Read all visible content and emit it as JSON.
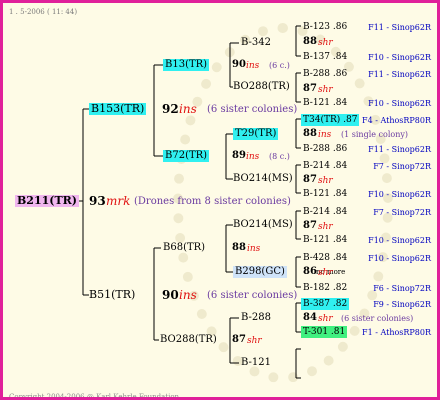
{
  "header": "1 .  5-2006 ( 11: 44)",
  "copyright": "Copyright 2004-2006 @ Karl Kehrle Foundation.",
  "root": {
    "label": "B211(TR)",
    "num": "93",
    "race": "mrk",
    "note": "(Drones from 8 sister colonies)"
  },
  "b153": {
    "label": "B153(TR)",
    "num": "92",
    "race": "ins",
    "note": "(6 sister colonies)"
  },
  "b51": {
    "label": "B51(TR)",
    "num": "90",
    "race": "ins",
    "note": "(6 sister colonies)"
  },
  "b13": {
    "label": "B13(TR)",
    "num": "90",
    "race": "ins",
    "note": "(6 c.)"
  },
  "b72": {
    "label": "B72(TR)",
    "num": "89",
    "race": "ins",
    "note": "(8 c.)"
  },
  "b68": {
    "label": "B68(TR)",
    "num": "88",
    "race": "ins"
  },
  "bo288_lower": {
    "label": "BO288(TR)",
    "num": "87",
    "race": "shr"
  },
  "g4": {
    "b342": "B-342",
    "bo288": "BO288(TR)",
    "t29": "T29(TR)",
    "bo214a": "BO214(MS)",
    "bo214b": "BO214(MS)",
    "b298": "B298(GC)",
    "b288": "B-288",
    "b121": "B-121"
  },
  "no_more": "no more",
  "rows": [
    {
      "label": "B-123 .86",
      "right": "F11 - Sinop62R"
    },
    {
      "num": "88",
      "race": "shr"
    },
    {
      "label": "B-137 .84",
      "right": "F10 - Sinop62R"
    },
    {
      "label": "B-288 .86",
      "right": "F11 - Sinop62R"
    },
    {
      "num": "87",
      "race": "shr"
    },
    {
      "label": "B-121 .84",
      "right": "F10 - Sinop62R"
    },
    {
      "label": "T34(TR) .87",
      "right": "F4 - AthosRP80R"
    },
    {
      "num": "88",
      "race": "ins",
      "note": "(1 single colony)"
    },
    {
      "label": "B-288 .86",
      "right": "F11 - Sinop62R"
    },
    {
      "label": "B-214 .84",
      "right": "F7 - Sinop72R"
    },
    {
      "num": "87",
      "race": "shr"
    },
    {
      "label": "B-121 .84",
      "right": "F10 - Sinop62R"
    },
    {
      "label": "B-214 .84",
      "right": "F7 - Sinop72R"
    },
    {
      "num": "87",
      "race": "shr"
    },
    {
      "label": "B-121 .84",
      "right": "F10 - Sinop62R"
    },
    {
      "label": "B-428 .84",
      "right": "F10 - Sinop62R"
    },
    {
      "num": "86",
      "race": "shr"
    },
    {
      "label": "B-182 .82",
      "right": "F6 - Sinop72R"
    },
    {
      "label": "B-387 .82",
      "right": "F9 - Sinop62R"
    },
    {
      "num": "84",
      "race": "shr",
      "note": "(6 sister colonies)"
    },
    {
      "label": "T-301 .81",
      "right": "F1 - AthosRP80R"
    }
  ]
}
